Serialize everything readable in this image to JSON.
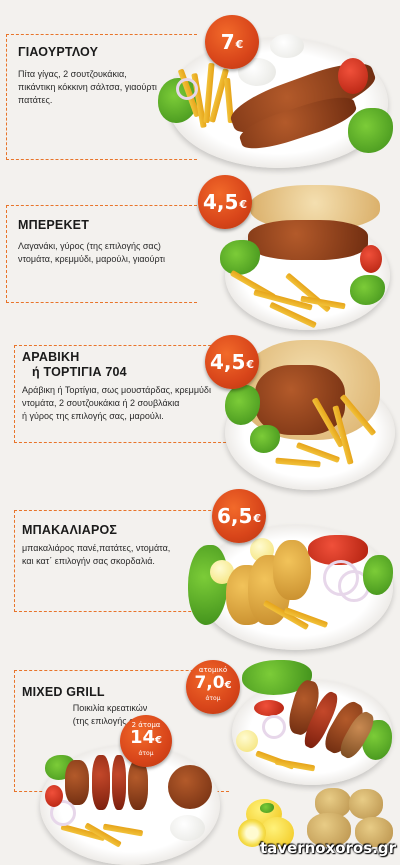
{
  "items": [
    {
      "title": "ΓΙΑΟΥΡΤΛΟΥ",
      "description_lines": [
        "Πίτα γίγας, 2 σουτζουκάκια,",
        "πικάντικη κόκκινη σάλτσα, γιαούρτι",
        "πατάτες."
      ],
      "price": "7",
      "currency": "€"
    },
    {
      "title": "ΜΠΕΡΕΚΕΤ",
      "description_lines": [
        "Λαγανάκι, γύρος (της επιλογής σας)",
        "ντομάτα, κρεμμύδι, μαρούλι, γιαούρτι"
      ],
      "price": "4,5",
      "currency": "€"
    },
    {
      "title_lines": [
        "ΑΡΑΒΙΚΗ",
        "ή ΤΟΡΤΙΓΙΑ 704"
      ],
      "description_lines": [
        "Αράβικη ή Τορτίγια, σως μουστάρδας, κρεμμύδι",
        "ντομάτα, 2 σουτζουκάκια ή 2 σουβλάκια",
        "ή γύρος της επιλογής σας, μαρούλι."
      ],
      "price": "4,5",
      "currency": "€"
    },
    {
      "title": "ΜΠΑΚΑΛΙΑΡΟΣ",
      "description_lines": [
        "μπακαλιάρος πανέ,πατάτες, ντομάτα,",
        "και κατ΄ επιλογήν σας σκορδαλιά."
      ],
      "price": "6,5",
      "currency": "€"
    },
    {
      "title": "MIXED GRILL",
      "description_lines": [
        "Ποικιλία κρεατικών",
        "(της επιλογής σας)"
      ],
      "price_single_label": "ατομικό",
      "price_single": "7,0",
      "price_single_unit": "€",
      "price_single_note": "άτομ",
      "price_double_label": "2 άτομα",
      "price_double": "14",
      "price_double_unit": "€",
      "price_double_note": "άτομ"
    }
  ],
  "watermark": "tavernoxoros.gr",
  "colors": {
    "accent": "#e8742a",
    "badge": "#d8451a",
    "background": "#f3f1ee"
  }
}
